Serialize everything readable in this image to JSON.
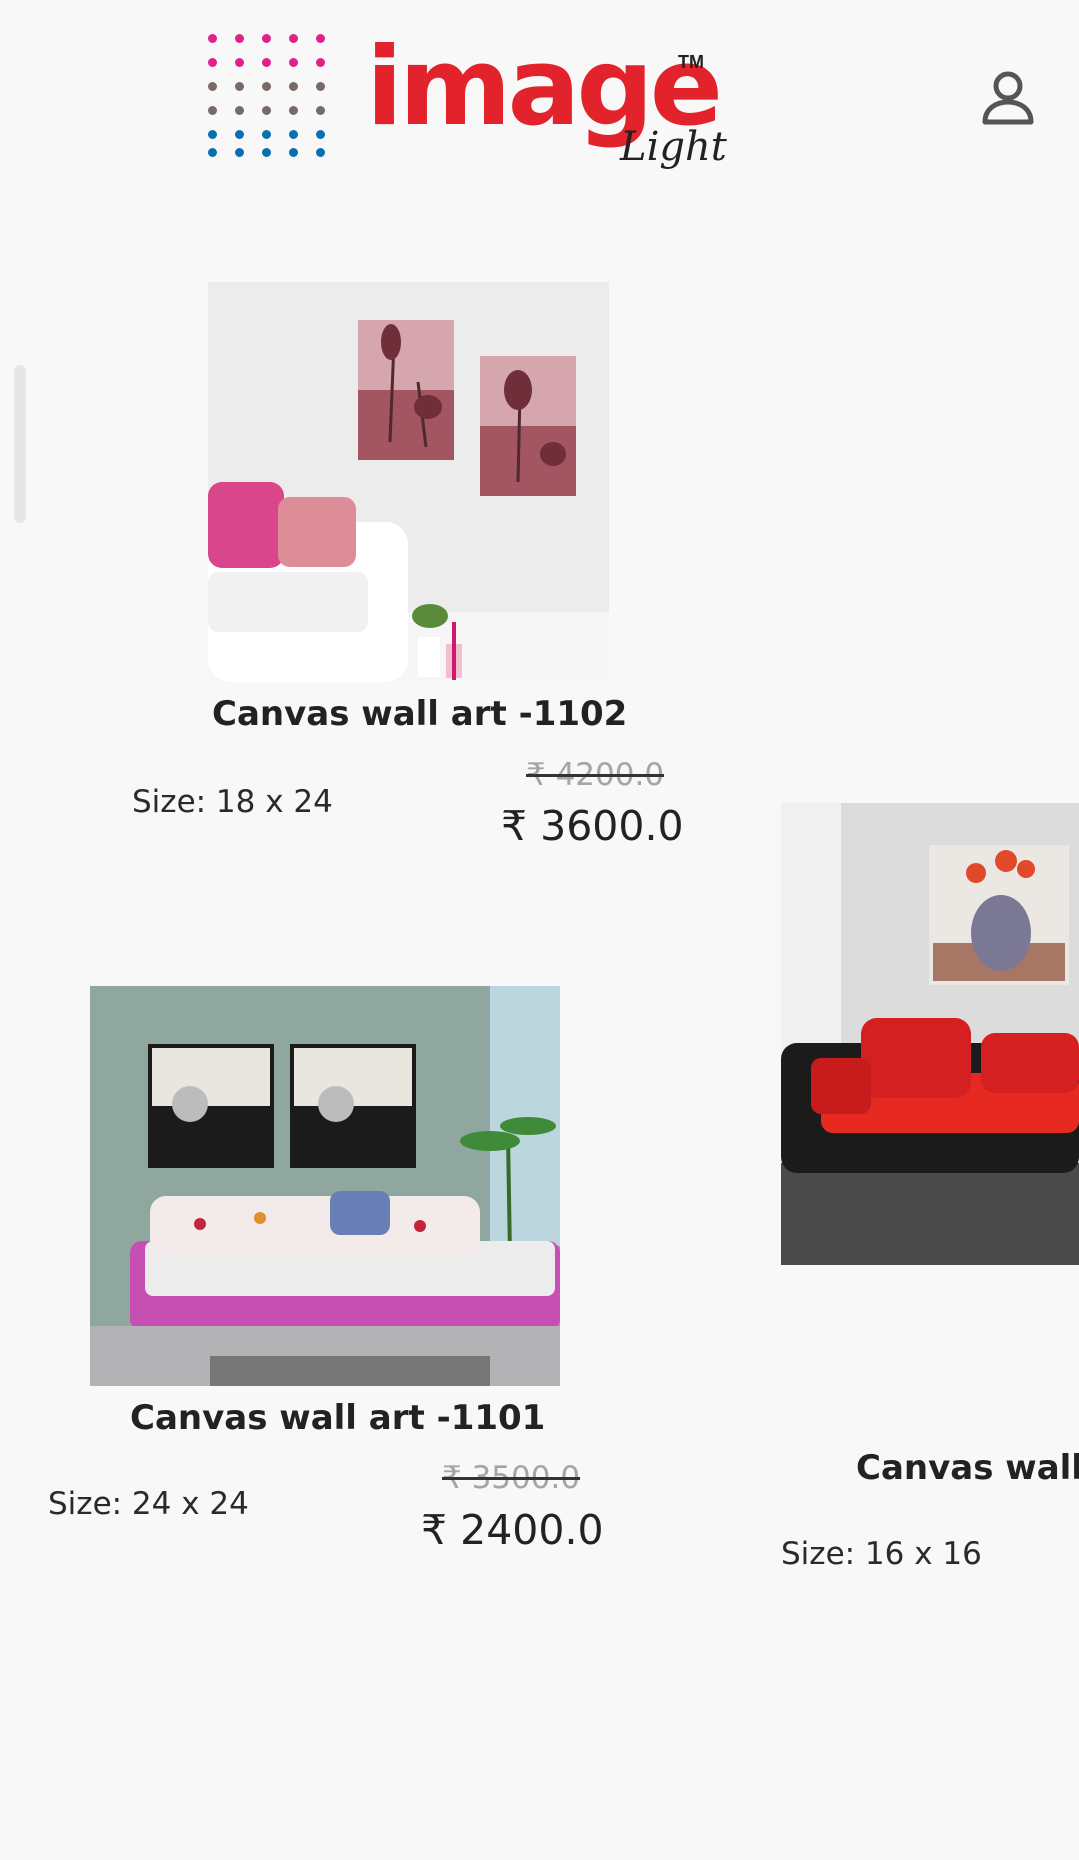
{
  "header": {
    "logo_word": "image",
    "logo_tm": "TM",
    "logo_sub": "Light",
    "dot_colors": [
      "#e0218a",
      "#7a6a66",
      "#0a6fae"
    ]
  },
  "icons": {
    "account": "user-icon"
  },
  "products": [
    {
      "title": "Canvas wall art -1102",
      "size": "Size: 18 x 24",
      "old_price": "₹ 4200.0",
      "price": "₹ 3600.0"
    },
    {
      "title": "Canvas wall art -1101",
      "size": "Size: 24 x 24",
      "old_price": "₹ 3500.0",
      "price": "₹ 2400.0"
    },
    {
      "title": "Canvas wall",
      "size": "Size: 16 x 16"
    }
  ],
  "colors": {
    "brand_red": "#e3232c",
    "background": "#f8f8f8"
  }
}
